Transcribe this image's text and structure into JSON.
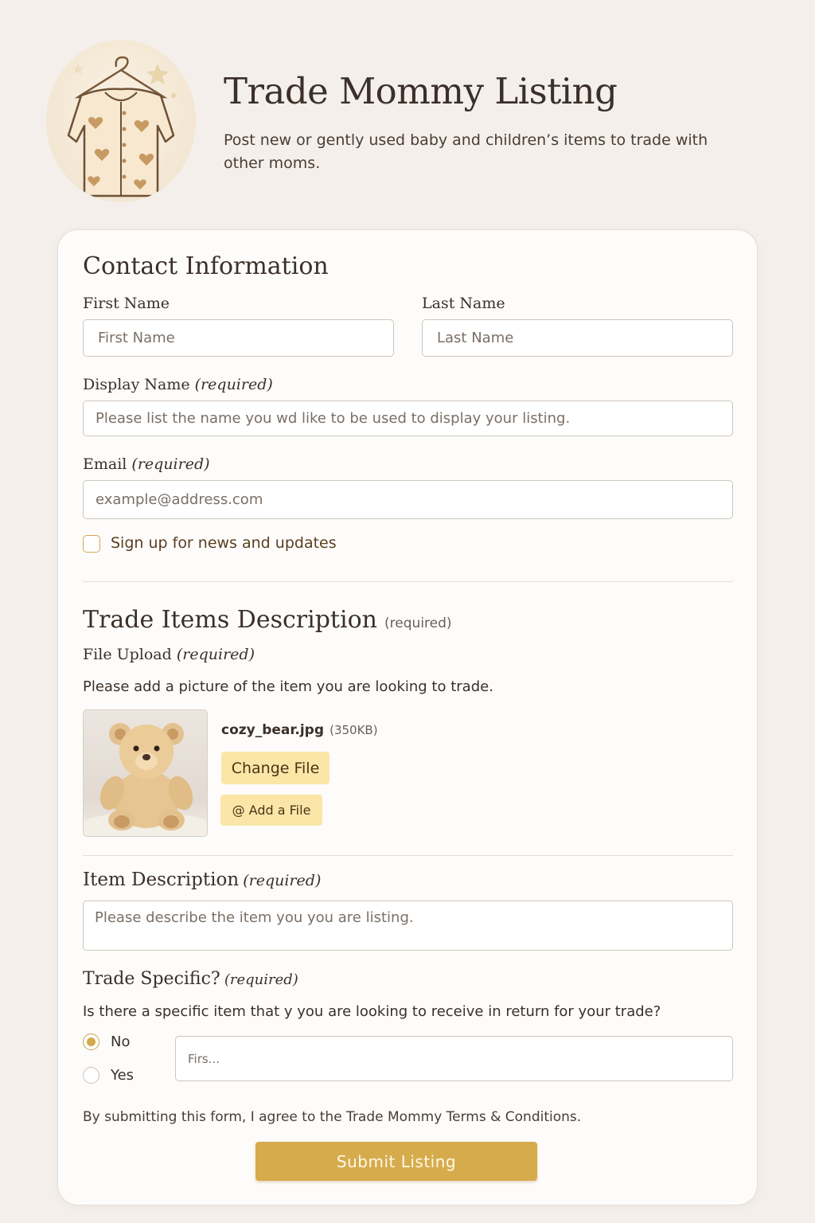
{
  "header": {
    "title": "Trade Mommy Listing",
    "subtitle": "Post new or gently used baby and children’s items to trade with other moms."
  },
  "contact": {
    "heading": "Contact Information",
    "first_name_label": "First Name",
    "first_name_placeholder": "First Name",
    "last_name_label": "Last Name",
    "last_name_placeholder": "Last Name",
    "display_name_label": "Display Name",
    "display_name_req": "(required)",
    "display_name_placeholder": "Please list the name you wd like to be used to display your listing.",
    "email_label": "Email",
    "email_req": "(required)",
    "email_placeholder": "example@address.com",
    "newsletter_label": "Sign up for news and updates",
    "newsletter_checked": false
  },
  "trade_items": {
    "heading": "Trade Items Description",
    "heading_req": "(required)",
    "upload_label": "File Upload",
    "upload_req": "(required)",
    "upload_hint": "Please add a picture of the item you are looking to trade.",
    "file_name": "cozy_bear.jpg",
    "file_size": "(350KB)",
    "change_file": "Change File",
    "add_file": "@ Add a File"
  },
  "item_description": {
    "label": "Item Description",
    "req": "(required)",
    "placeholder": "Please describe the item you you are  listing."
  },
  "trade_specific": {
    "label": "Trade Specific?",
    "req": "(required)",
    "question": "Is there a specific item that y you are looking to receive in return for your trade?",
    "options": [
      {
        "label": "No",
        "selected": true
      },
      {
        "label": "Yes",
        "selected": false
      }
    ],
    "field_placeholder": "Firs..."
  },
  "footer": {
    "terms": "By submitting this form, I agree to the Trade Mommy Terms & Conditions.",
    "submit": "Submit Listing"
  },
  "colors": {
    "accent": "#d6ab4c",
    "pale_button": "#fbe6a8",
    "background": "#f4efeb"
  }
}
